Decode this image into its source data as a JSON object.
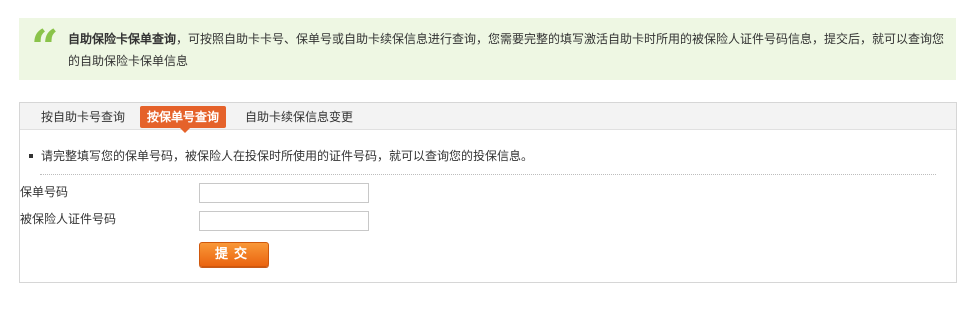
{
  "notice": {
    "icon": "quote-icon",
    "icon_char": "“",
    "title": "自助保险卡保单查询",
    "body": "，可按照自助卡卡号、保单号或自助卡续保信息进行查询，您需要完整的填写激活自助卡时所用的被保险人证件号码信息，提交后，就可以查询您的自助保险卡保单信息"
  },
  "tabs": [
    {
      "label": "按自助卡号查询",
      "active": false
    },
    {
      "label": "按保单号查询",
      "active": true
    },
    {
      "label": "自助卡续保信息变更",
      "active": false
    }
  ],
  "hint": "请完整填写您的保单号码，被保险人在投保时所使用的证件号码，就可以查询您的投保信息。",
  "form": {
    "policy_label": "保单号码",
    "policy_value": "",
    "id_label": "被保险人证件号码",
    "id_value": "",
    "submit_label": "提交"
  },
  "colors": {
    "notice_bg": "#eef7e3",
    "quote_icon": "#8ac34a",
    "active_tab": "#e5622a",
    "submit_button": "#f07a20"
  }
}
